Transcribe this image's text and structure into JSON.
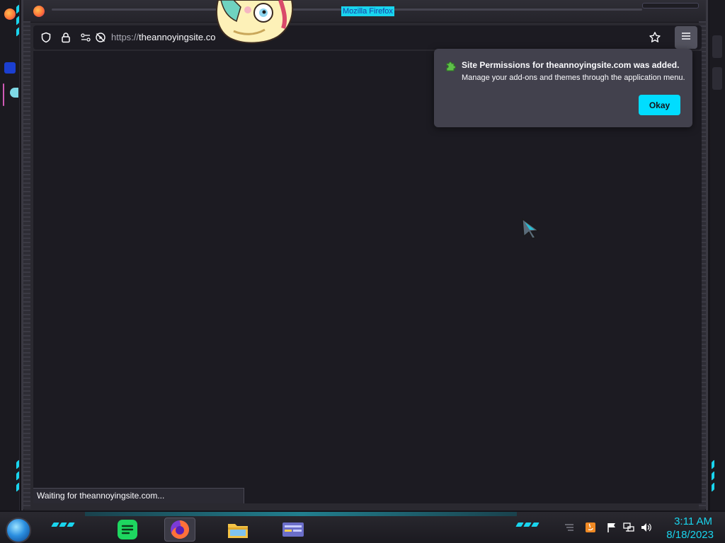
{
  "window": {
    "title": "Mozilla Firefox"
  },
  "navbar": {
    "url_scheme": "https://",
    "url_host": "theannoyingsite.co",
    "icons": [
      "shield-icon",
      "lock-icon",
      "permissions-icon",
      "autoplay-blocked-icon",
      "bookmark-star-icon",
      "hamburger-menu-icon"
    ]
  },
  "popup": {
    "icon": "puzzle-piece-icon",
    "title": "Site Permissions for theannoyingsite.com was added.",
    "body": "Manage your add-ons and themes through the application menu.",
    "ok_label": "Okay"
  },
  "status": {
    "text": "Waiting for theannoyingsite.com..."
  },
  "taskbar": {
    "apps": [
      "spotify-icon",
      "firefox-icon",
      "file-explorer-icon",
      "window-manager-icon"
    ],
    "tray": [
      "overflow-icon",
      "java-icon",
      "flag-icon",
      "network-icon",
      "volume-icon"
    ],
    "time": "3:11 AM",
    "date": "8/18/2023"
  },
  "colors": {
    "accent_cyan": "#00ddff",
    "content_bg": "#1c1b22",
    "popup_bg": "#42414d",
    "clock_cyan": "#19d5ee"
  }
}
